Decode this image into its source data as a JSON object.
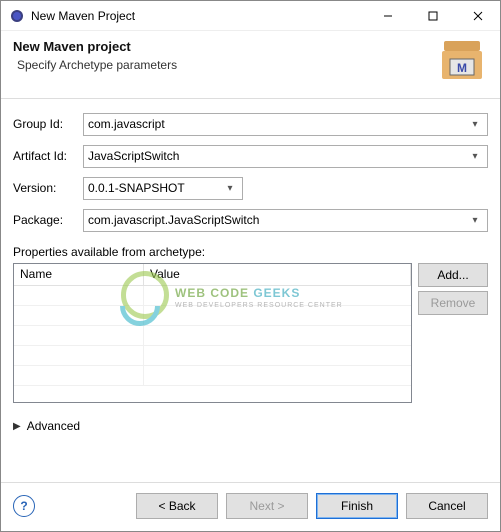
{
  "titlebar": {
    "title": "New Maven Project"
  },
  "banner": {
    "heading": "New Maven project",
    "sub": "Specify Archetype parameters"
  },
  "form": {
    "groupIdLabel": "Group Id:",
    "groupIdValue": "com.javascript",
    "artifactIdLabel": "Artifact Id:",
    "artifactIdValue": "JavaScriptSwitch",
    "versionLabel": "Version:",
    "versionValue": "0.0.1-SNAPSHOT",
    "packageLabel": "Package:",
    "packageValue": "com.javascript.JavaScriptSwitch",
    "propsLabel": "Properties available from archetype:",
    "cols": {
      "name": "Name",
      "value": "Value"
    },
    "addBtn": "Add...",
    "removeBtn": "Remove",
    "advanced": "Advanced"
  },
  "footer": {
    "back": "< Back",
    "next": "Next >",
    "finish": "Finish",
    "cancel": "Cancel"
  },
  "watermark": {
    "big1": "WEB CODE ",
    "big2": "GEEKS",
    "small": "WEB DEVELOPERS RESOURCE CENTER"
  }
}
